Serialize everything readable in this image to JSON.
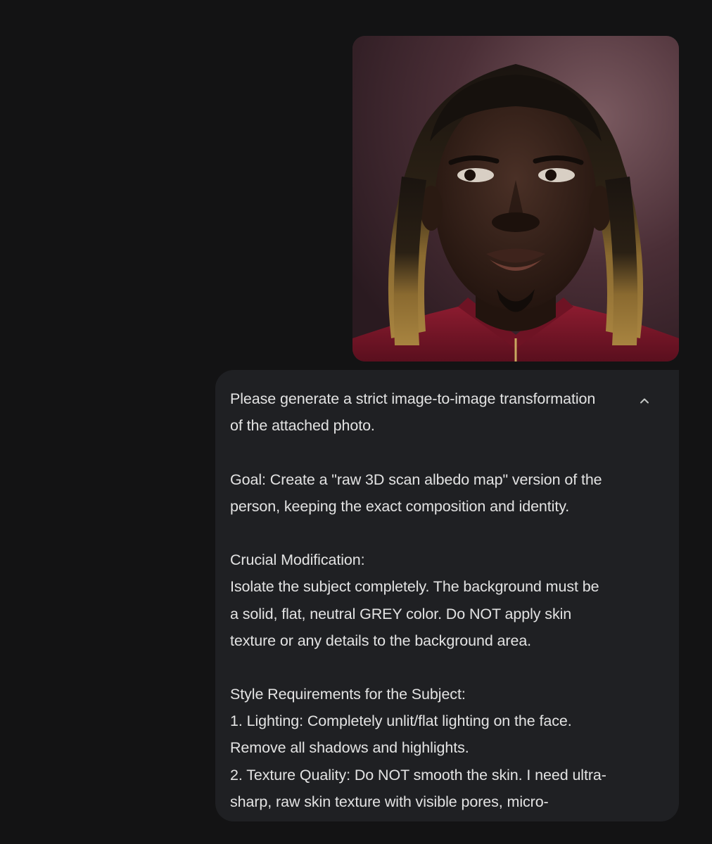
{
  "attachment": {
    "kind": "photo",
    "alt": ""
  },
  "message": {
    "lines": [
      "Please generate a strict image-to-image transformation",
      "of the attached photo.",
      "",
      "Goal: Create a \"raw 3D scan albedo map\" version of the",
      "person, keeping the exact composition and identity.",
      "",
      "Crucial Modification:",
      "Isolate the subject completely. The background must be",
      "a solid, flat, neutral GREY color. Do NOT apply skin",
      "texture or any details to the background area.",
      "",
      "Style Requirements for the Subject:",
      "1. Lighting: Completely unlit/flat lighting on the face.",
      "Remove all shadows and highlights.",
      "2. Texture Quality: Do NOT smooth the skin. I need ultra-",
      "sharp, raw skin texture with visible pores, micro-"
    ],
    "collapse_icon": "chevron-up-icon"
  },
  "colors": {
    "background": "#131314",
    "bubble": "#1f2023",
    "text": "#e3e3e3"
  }
}
